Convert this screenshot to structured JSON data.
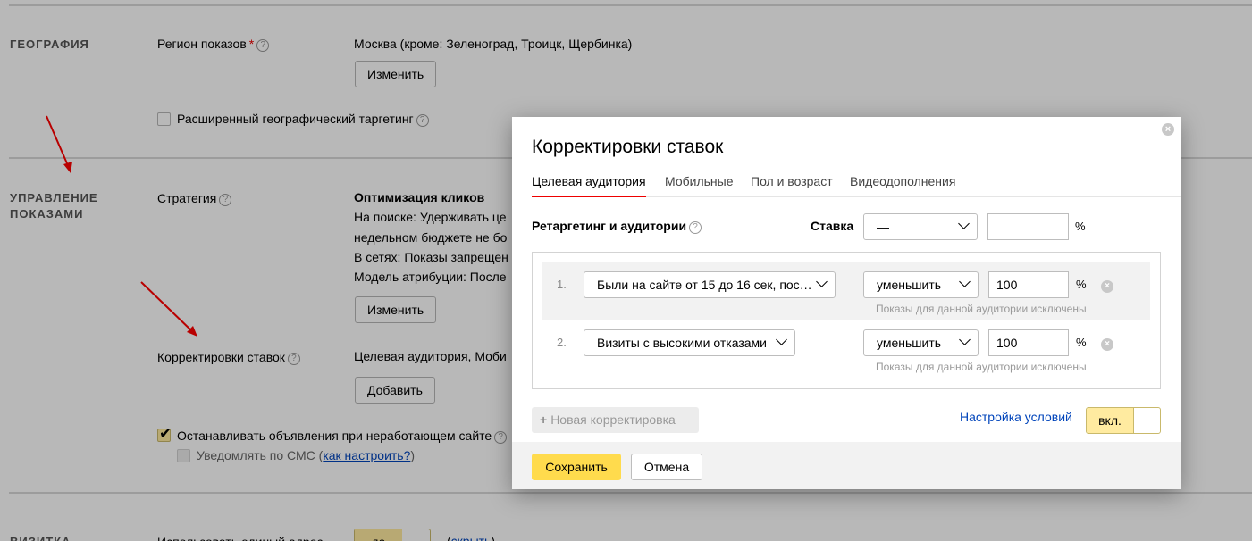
{
  "geo": {
    "section_title": "ГЕОГРАФИЯ",
    "region_label": "Регион показов",
    "region_value": "Москва (кроме: Зеленоград, Троицк, Щербинка)",
    "change_button": "Изменить",
    "extended_geo_label": "Расширенный географический таргетинг"
  },
  "management": {
    "section_title_line1": "УПРАВЛЕНИЕ",
    "section_title_line2": "ПОКАЗАМИ",
    "strategy_label": "Стратегия",
    "strategy_title": "Оптимизация кликов",
    "strategy_line1": "На поиске: Удерживать це",
    "strategy_line2": "недельном бюджете не бо",
    "strategy_line3": "В сетях: Показы запрещен",
    "strategy_line4": "Модель атрибуции: После",
    "change_button": "Изменить",
    "bid_adj_label": "Корректировки ставок",
    "bid_adj_value": "Целевая аудитория, Моби",
    "add_button": "Добавить",
    "stop_ads_label": "Останавливать объявления при неработающем сайте",
    "sms_label": "Уведомлять по СМС (",
    "sms_link": "как настроить?",
    "sms_suffix": ")"
  },
  "vizitka": {
    "section_title": "ВИЗИТКА",
    "field_label": "Использовать единый адрес",
    "toggle_label": "да",
    "hide_link": "скрыть"
  },
  "modal": {
    "title": "Корректировки ставок",
    "close_glyph": "×",
    "tabs": [
      "Целевая аудитория",
      "Мобильные",
      "Пол и возраст",
      "Видеодополнения"
    ],
    "retargeting_label": "Ретаргетинг и аудитории",
    "rate_label": "Ставка",
    "rate_select": "—",
    "rate_value": "",
    "percent": "%",
    "rules": [
      {
        "num": "1.",
        "audience": "Были на сайте от 15 до 16 сек, пос…",
        "action": "уменьшить",
        "value": "100",
        "hint": "Показы для данной аудитории исключены"
      },
      {
        "num": "2.",
        "audience": "Визиты с высокими отказами",
        "action": "уменьшить",
        "value": "100",
        "hint": "Показы для данной аудитории исключены"
      }
    ],
    "new_rule_button": "Новая корректировка",
    "conditions_link": "Настройка условий",
    "toggle_label": "вкл.",
    "save_button": "Сохранить",
    "cancel_button": "Отмена"
  },
  "colors": {
    "accent_yellow": "#ffdb4d",
    "tab_underline": "#e00000",
    "link": "#0044bb",
    "arrow": "#ff0000"
  }
}
